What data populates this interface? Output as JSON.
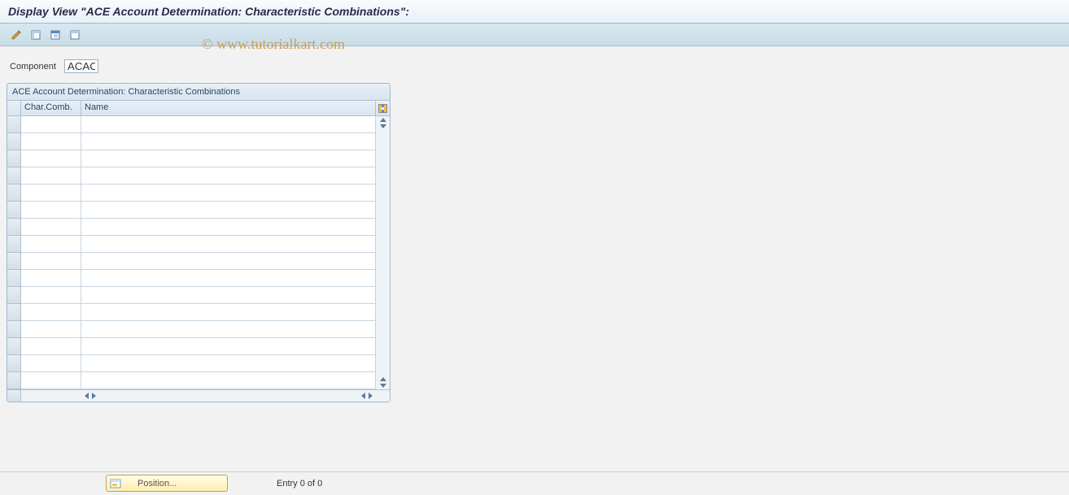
{
  "title": "Display View \"ACE Account Determination: Characteristic Combinations\":",
  "watermark": "© www.tutorialkart.com",
  "toolbar": {
    "btn1_name": "change-display-icon",
    "btn2_name": "select-all-icon",
    "btn3_name": "select-block-icon",
    "btn4_name": "deselect-all-icon"
  },
  "component": {
    "label": "Component",
    "value": "ACAC"
  },
  "table": {
    "title": "ACE Account Determination: Characteristic Combinations",
    "columns": {
      "char_comb": "Char.Comb.",
      "name": "Name"
    },
    "row_count": 16
  },
  "footer": {
    "position_label": "Position...",
    "entry_text": "Entry 0 of 0"
  }
}
